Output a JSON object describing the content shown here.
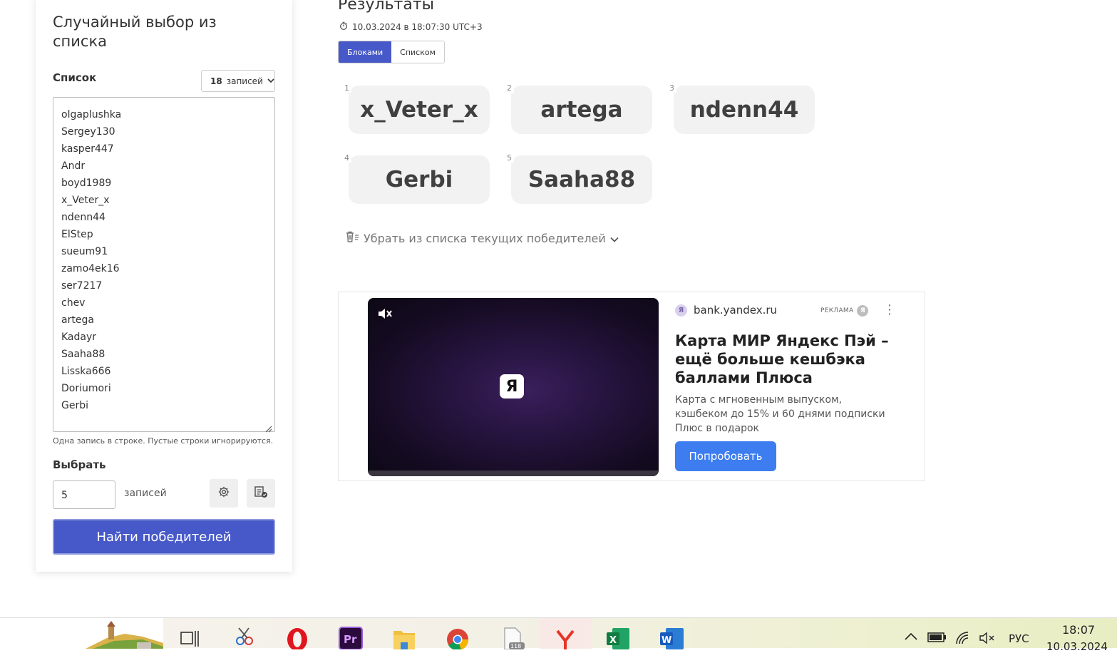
{
  "sidebar": {
    "title": "Случайный выбор из списка",
    "list_label": "Список",
    "count_num": "18",
    "count_word": "записей",
    "entries": [
      "olgaplushka",
      "Sergey130",
      "kasper447",
      "Andr",
      "boyd1989",
      "x_Veter_x",
      "ndenn44",
      "ElStep",
      "sueum91",
      "zamo4ek16",
      "ser7217",
      "chev",
      "artega",
      "Kadayr",
      "Saaha88",
      "Lisska666",
      "Doriumori",
      "Gerbi"
    ],
    "hint": "Одна запись в строке. Пустые строки игнорируются.",
    "pick_label": "Выбрать",
    "pick_value": "5",
    "pick_unit": "записей",
    "find_button": "Найти победителей"
  },
  "results": {
    "title": "Результаты",
    "timestamp": "10.03.2024 в 18:07:30 UTC+3",
    "view_blocks": "Блоками",
    "view_list": "Списком",
    "winners": [
      {
        "num": "1",
        "name": "x_Veter_x"
      },
      {
        "num": "2",
        "name": "artega"
      },
      {
        "num": "3",
        "name": "ndenn44"
      },
      {
        "num": "4",
        "name": "Gerbi"
      },
      {
        "num": "5",
        "name": "Saaha88"
      }
    ],
    "remove_label": "Убрать из списка текущих победителей"
  },
  "ad": {
    "domain": "bank.yandex.ru",
    "tag": "РЕКЛАМА",
    "headline": "Карта МИР Яндекс Пэй – ещё больше кешбэка баллами Плюса",
    "body": "Карта с мгновенным выпуском, кэшбеком до 15% и 60 днями подписки Плюс в подарок",
    "button": "Попробовать",
    "logo_letter": "Я"
  },
  "taskbar": {
    "file_badge": "118",
    "language": "РУС",
    "time": "18:07",
    "date": "10.03.2024"
  },
  "colors": {
    "accent": "#4759c8",
    "ad_button": "#3d7df0",
    "card_bg": "#f2f2f2"
  }
}
